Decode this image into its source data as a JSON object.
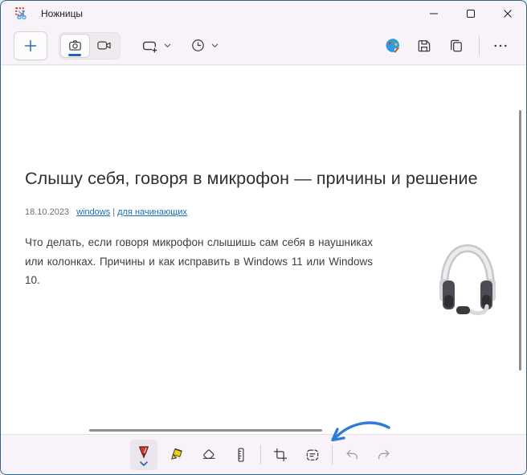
{
  "window": {
    "title": "Ножницы",
    "controls": [
      "minimize",
      "maximize",
      "close"
    ]
  },
  "top_toolbar": {
    "new_button": "new-snip-plus",
    "modes": [
      "screenshot-camera",
      "video-recorder"
    ],
    "selected_mode": "screenshot-camera",
    "snip_shape_selector": "rectangle-snip",
    "delay_selector": "timer-clock",
    "right_actions": [
      "edit-in-paint",
      "save",
      "copy",
      "see-more"
    ]
  },
  "snip": {
    "article": {
      "title": "Слышу себя, говоря в микрофон — причины и решение",
      "date": "18.10.2023",
      "link_windows": "windows",
      "separator": "|",
      "link_beginners": "для начинающих",
      "body": "Что делать, если говоря микрофон слышишь сам себя в наушниках или колонках. Причины и как исправить в Windows 11 или Windows 10.",
      "image": "white-headset-with-microphone"
    }
  },
  "bottom_toolbar": {
    "tools": [
      "ballpoint-pen",
      "highlighter",
      "eraser",
      "ruler",
      "crop",
      "text-actions",
      "undo",
      "redo"
    ],
    "selected_tool": "ballpoint-pen",
    "disabled_tools": [
      "undo",
      "redo"
    ],
    "annotation": "blue-curved-arrow-pointing-at-text-actions"
  },
  "colors": {
    "window_border": "#30638c",
    "chrome_bg": "#f8f3f8",
    "accent_blue": "#1f66c0",
    "link_blue": "#1a6cbe",
    "arrow_blue": "#2e7cd6",
    "pen_red": "#cf3a2c",
    "highlighter_yellow": "#f5d10a"
  }
}
